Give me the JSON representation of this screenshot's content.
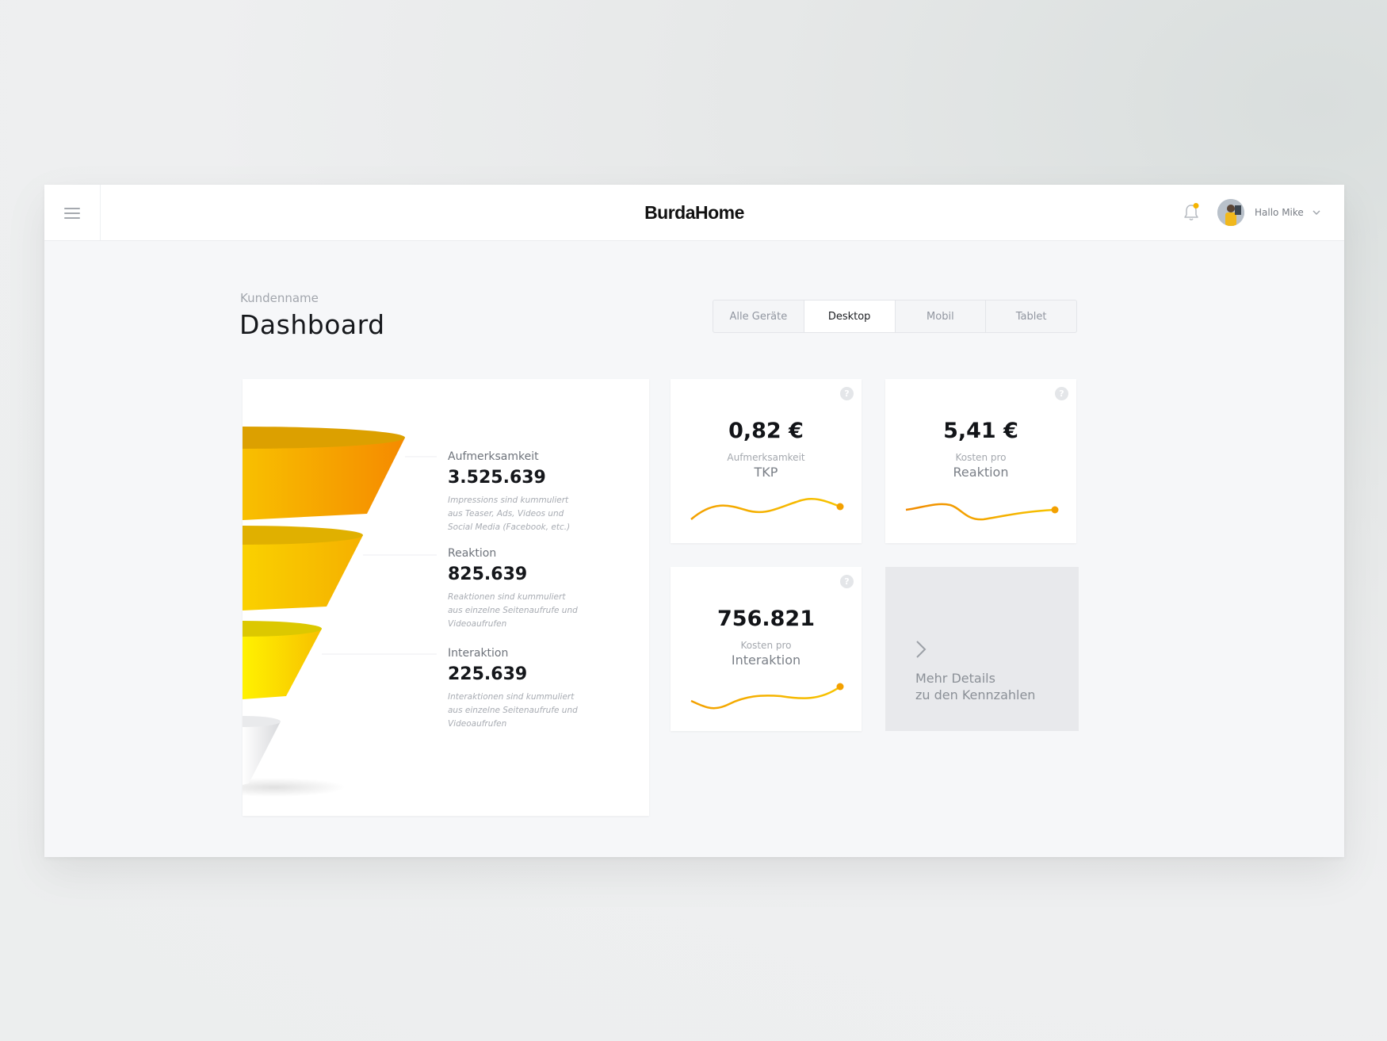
{
  "app": {
    "brand": "BurdaHome",
    "user_greeting": "Hallo Mike"
  },
  "header": {
    "subtitle": "Kundenname",
    "title": "Dashboard"
  },
  "tabs": [
    {
      "label": "Alle Geräte",
      "active": false
    },
    {
      "label": "Desktop",
      "active": true
    },
    {
      "label": "Mobil",
      "active": false
    },
    {
      "label": "Tablet",
      "active": false
    }
  ],
  "funnel": {
    "stages": [
      {
        "label": "Aufmerksamkeit",
        "value": "3.525.639",
        "note": "Impressions sind kummuliert aus Teaser, Ads, Videos und Social Media (Facebook, etc.)"
      },
      {
        "label": "Reaktion",
        "value": "825.639",
        "note": "Reaktionen sind kummuliert aus einzelne Seitenaufrufe und Videoaufrufen"
      },
      {
        "label": "Interaktion",
        "value": "225.639",
        "note": "Interaktionen sind kummuliert aus einzelne Seitenaufrufe und Videoaufrufen"
      }
    ]
  },
  "kpis": [
    {
      "value": "0,82 €",
      "sub": "Aufmerksamkeit",
      "name": "TKP"
    },
    {
      "value": "5,41 €",
      "sub": "Kosten pro",
      "name": "Reaktion"
    },
    {
      "value": "756.821",
      "sub": "Kosten pro",
      "name": "Interaktion"
    }
  ],
  "more_details": {
    "line1": "Mehr Details",
    "line2": "zu den Kennzahlen"
  },
  "colors": {
    "accent": "#f5b400",
    "accent_dark": "#f08a00",
    "text": "#15171b",
    "muted": "#a4a8ae"
  },
  "icons": [
    "menu-icon",
    "bell-icon",
    "chevron-down-icon",
    "help-icon",
    "chevron-right-icon"
  ]
}
